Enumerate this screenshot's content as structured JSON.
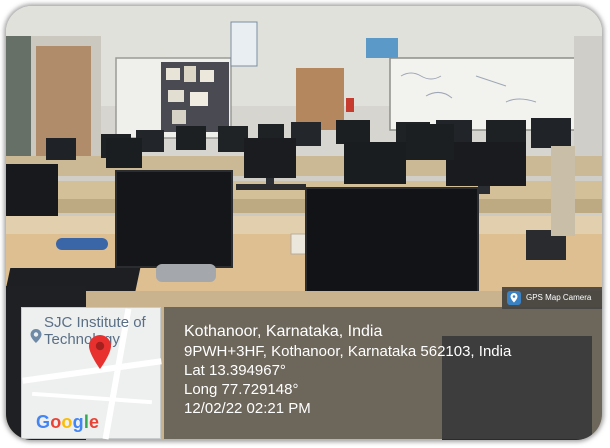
{
  "map": {
    "place_label": "SJC Institute of Technology",
    "provider": "Google",
    "provider_colors": [
      "#4285F4",
      "#EA4335",
      "#FBBC05",
      "#4285F4",
      "#34A853",
      "#EA4335"
    ]
  },
  "location": {
    "title": "Kothanoor, Karnataka, India",
    "address": "9PWH+3HF, Kothanoor, Karnataka 562103, India",
    "lat": "Lat 13.394967°",
    "long": "Long 77.729148°",
    "timestamp": "12/02/22 02:21 PM"
  },
  "app_tag": {
    "label": "GPS Map Camera"
  },
  "colors": {
    "pin": "#e8312f",
    "overlay": "#464646",
    "wall": "#d8d8d2",
    "desk": "#d9b98c"
  }
}
